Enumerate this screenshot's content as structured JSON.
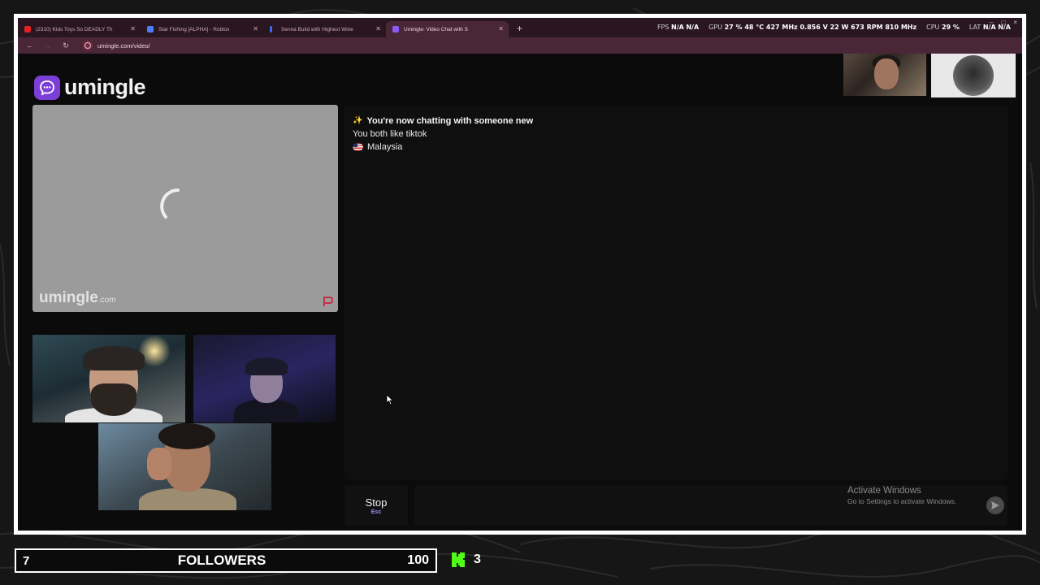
{
  "browser": {
    "tabs": [
      {
        "title": "(2310) Kids Toys So DEADLY Th",
        "icon": "youtube-icon",
        "color": "#e02424",
        "active": false
      },
      {
        "title": "Star Fishing [ALPHA] - Roblox",
        "icon": "roblox-icon",
        "color": "#4f7cff",
        "active": false
      },
      {
        "title": "Senna Build with Highest Wine",
        "icon": "site-icon",
        "color": "#3a6cf0",
        "active": false
      },
      {
        "title": "Umingle: Video Chat with S",
        "icon": "umingle-icon",
        "color": "#8b5cf6",
        "active": true
      }
    ],
    "new_tab": "+",
    "url": "umingle.com/video/",
    "window_controls": [
      "–",
      "□",
      "×"
    ]
  },
  "perf": {
    "fps_label": "FPS",
    "fps_val1": "N/A",
    "fps_val2": "N/A",
    "gpu_label": "GPU",
    "gpu_stats": "27 % 48 °C 427 MHz 0.856 V 22 W 673 RPM 810 MHz",
    "cpu_label": "CPU",
    "cpu_stats": "29 %",
    "lat_label": "LAT",
    "lat_val1": "N/A",
    "lat_val2": "N/A"
  },
  "app": {
    "logo_text": "umingle",
    "stranger_watermark": "umingle",
    "stranger_watermark_suffix": ".com",
    "accent": "#7b3fd8"
  },
  "chat": {
    "status_sparkle": "✨",
    "status": "You're now chatting with someone new",
    "interest": "You both like tiktok",
    "country": "Malaysia"
  },
  "controls": {
    "stop_label": "Stop",
    "stop_key": "Esc",
    "message_placeholder": ""
  },
  "windows_notice": {
    "title": "Activate Windows",
    "subtitle": "Go to Settings to activate Windows."
  },
  "overlay": {
    "followers_count": "7",
    "followers_label": "FOLLOWERS",
    "followers_goal": "100",
    "kick_count": "3",
    "kick_color": "#53fc18"
  }
}
